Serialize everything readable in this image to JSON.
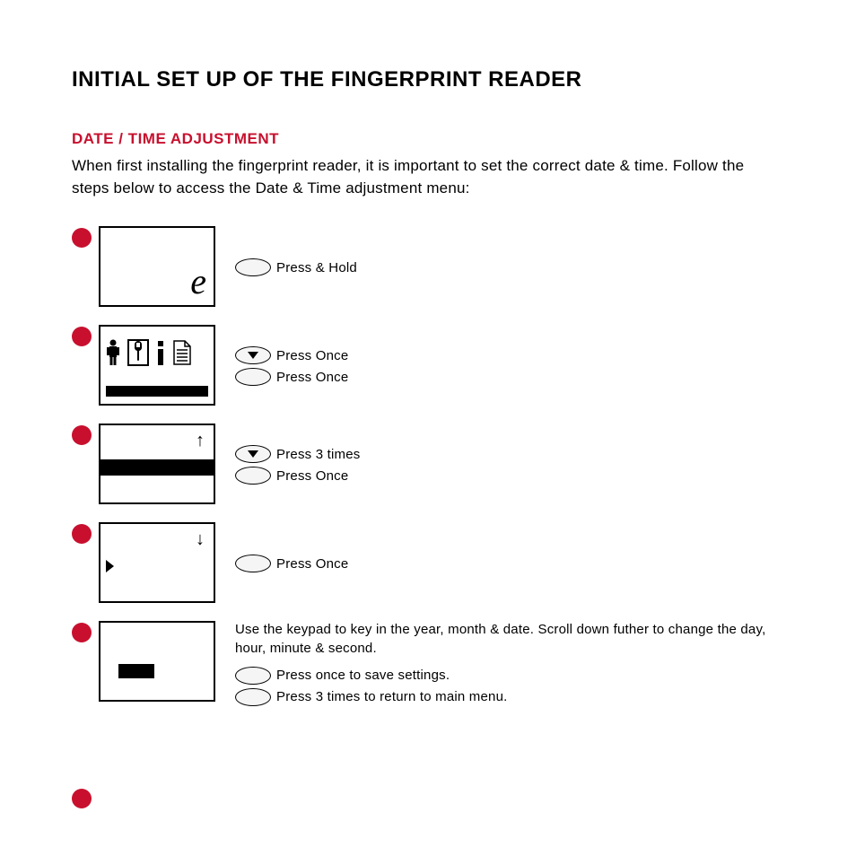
{
  "title": "INITIAL SET UP OF THE FINGERPRINT READER",
  "section": "DATE / TIME ADJUSTMENT",
  "intro": "When first installing the fingerprint reader, it is important to set the correct date & time. Follow the steps below to access the Date & Time adjustment menu:",
  "steps": {
    "s1": {
      "a": "Press & Hold"
    },
    "s2": {
      "a": "Press Once",
      "b": "Press Once"
    },
    "s3": {
      "a": "Press 3 times",
      "b": "Press Once"
    },
    "s4": {
      "a": "Press Once"
    },
    "s5": {
      "para": "Use the keypad to key in the year, month & date. Scroll down futher to change the day, hour, minute & second.",
      "a": "Press once to save settings.",
      "b": "Press 3 times to return to main menu."
    }
  },
  "icons": {
    "button_blank": "blank-button-icon",
    "button_down": "down-button-icon",
    "logo": "e-logo-icon",
    "person": "person-icon",
    "wrench": "wrench-icon",
    "info": "info-icon",
    "doc": "document-icon",
    "arrow_up": "arrow-up-icon",
    "arrow_down": "arrow-down-icon",
    "caret_right": "caret-right-icon"
  }
}
